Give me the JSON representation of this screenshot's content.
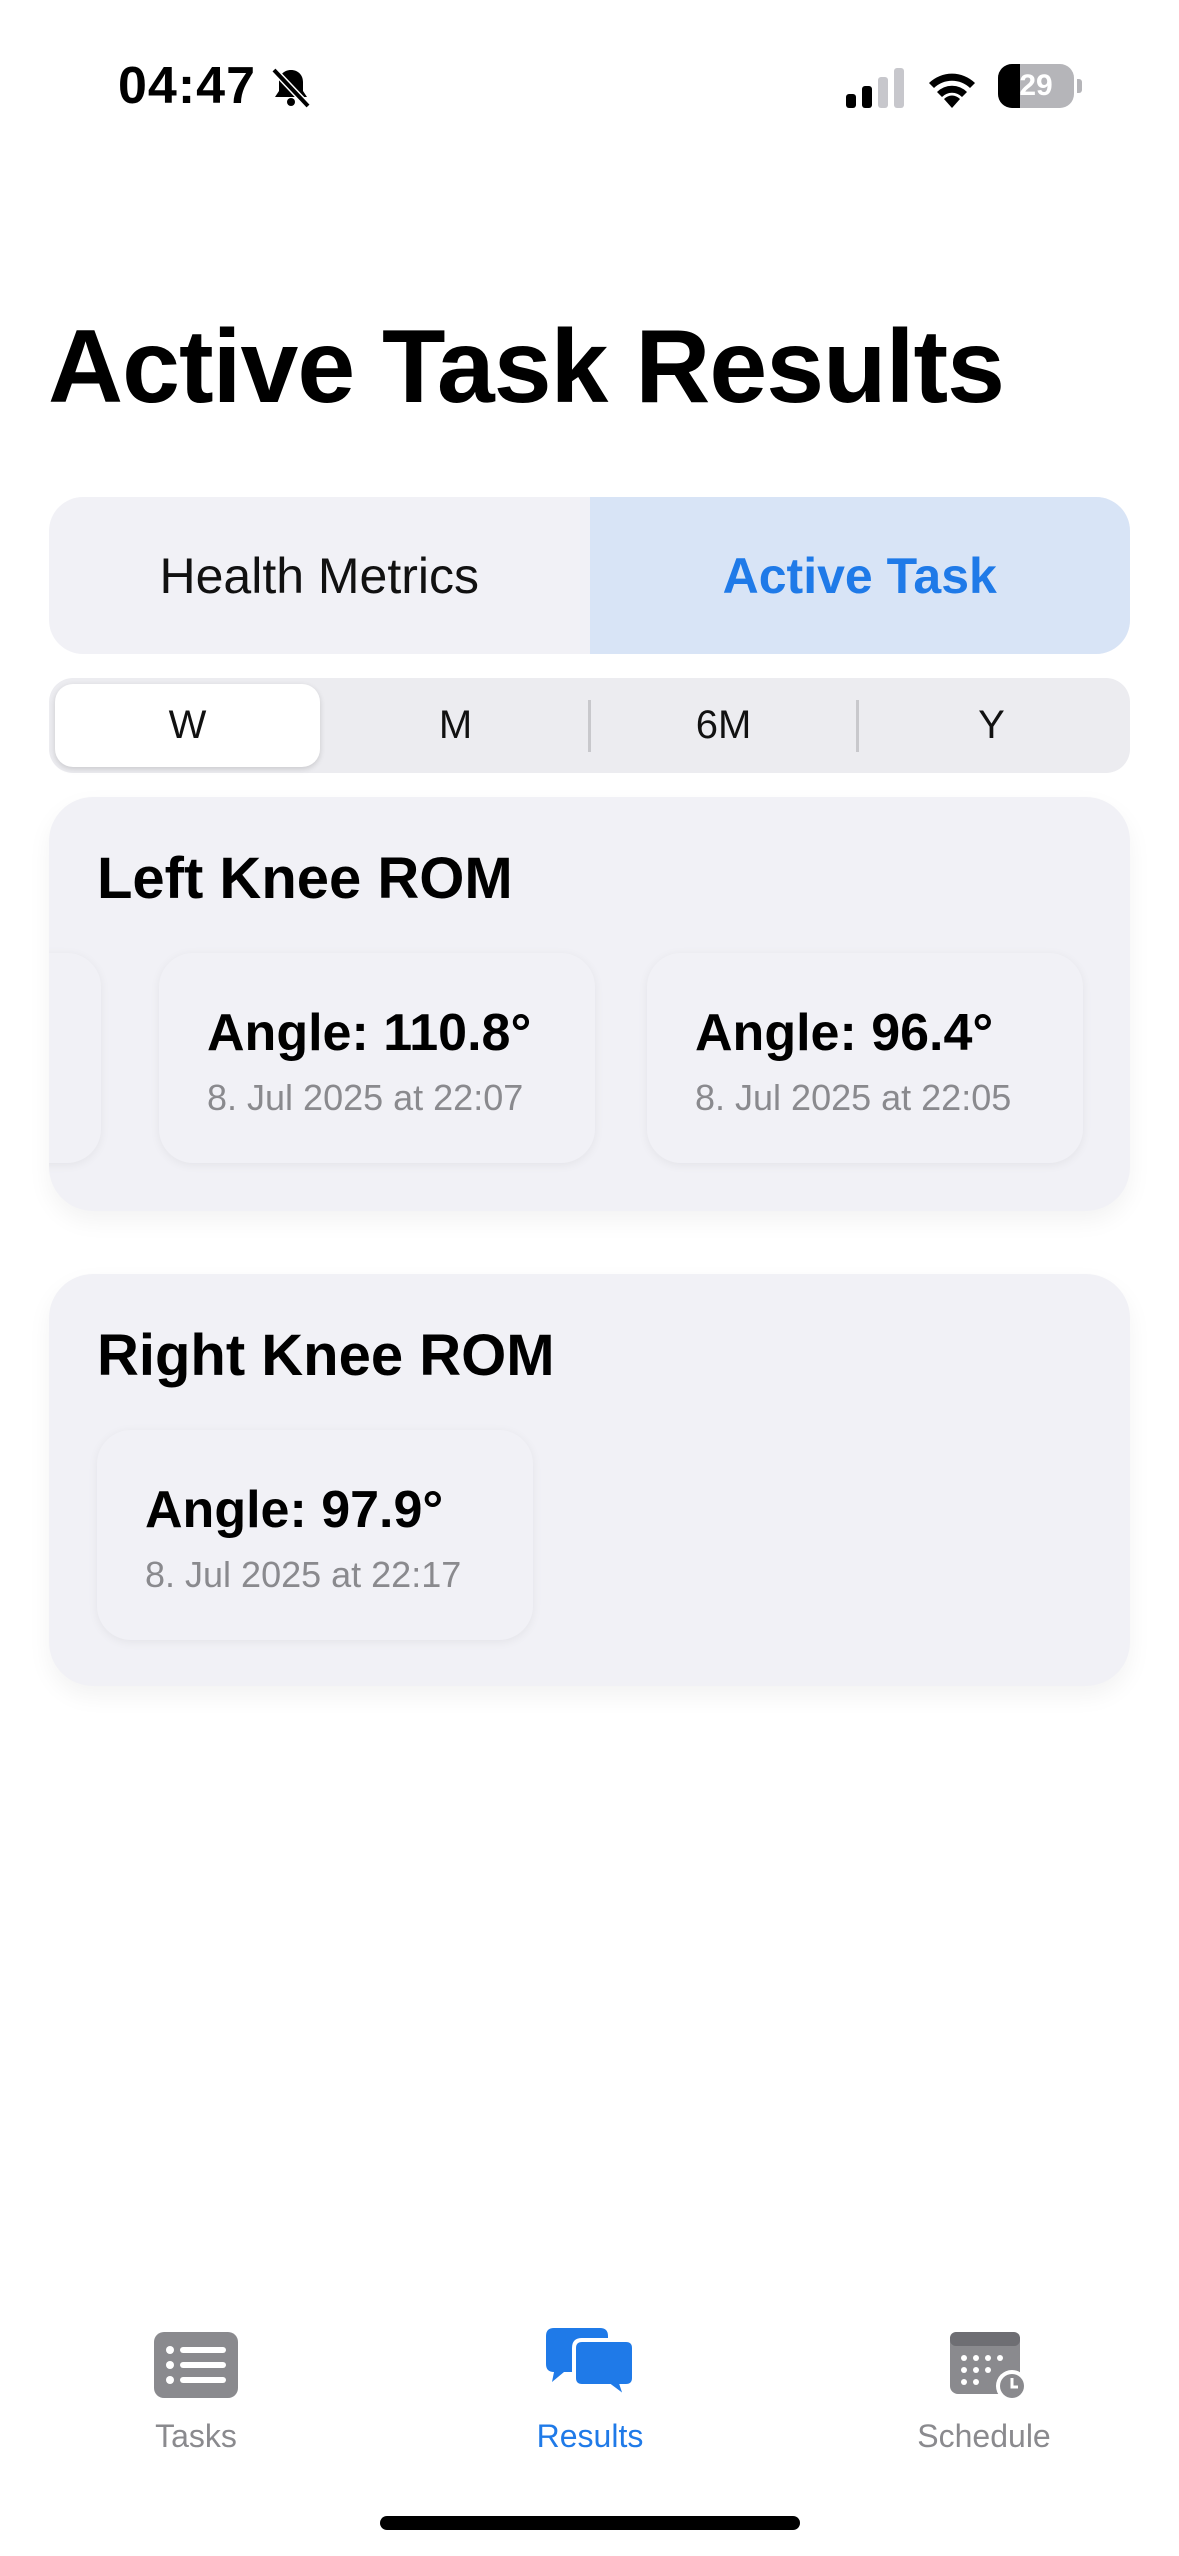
{
  "status_bar": {
    "time": "04:47",
    "battery_level": "29",
    "battery_fraction": 0.29
  },
  "page_title": "Active Task Results",
  "primary_tabs": [
    {
      "label": "Health Metrics",
      "selected": false
    },
    {
      "label": "Active Task",
      "selected": true
    }
  ],
  "range_tabs": [
    {
      "label": "W",
      "selected": true
    },
    {
      "label": "M",
      "selected": false
    },
    {
      "label": "6M",
      "selected": false
    },
    {
      "label": "Y",
      "selected": false
    }
  ],
  "left_knee": {
    "title": "Left Knee ROM",
    "readings": [
      {
        "angle": "Angle: 110.8°",
        "date": "8. Jul 2025 at 22:07"
      },
      {
        "angle": "Angle: 96.4°",
        "date": "8. Jul 2025 at 22:05"
      }
    ]
  },
  "right_knee": {
    "title": "Right Knee ROM",
    "readings": [
      {
        "angle": "Angle: 97.9°",
        "date": "8. Jul 2025 at 22:17"
      }
    ]
  },
  "tab_bar": [
    {
      "label": "Tasks",
      "icon": "list-icon",
      "selected": false
    },
    {
      "label": "Results",
      "icon": "chat-bubbles-icon",
      "selected": true
    },
    {
      "label": "Schedule",
      "icon": "calendar-clock-icon",
      "selected": false
    }
  ],
  "colors": {
    "accent": "#1f7ae8",
    "card_bg": "#f1f1f6",
    "secondary_text": "#8a8a8e"
  }
}
